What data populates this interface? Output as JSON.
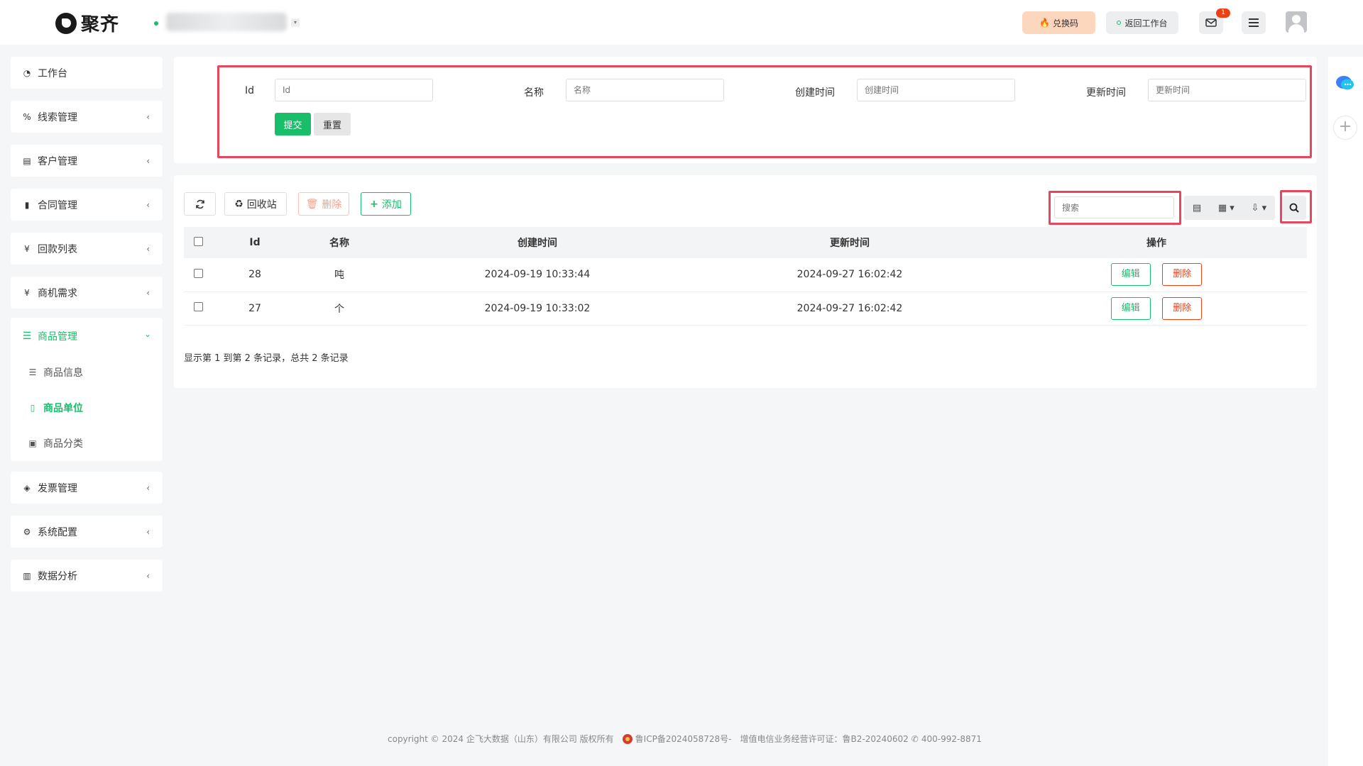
{
  "header": {
    "brand": "聚齐",
    "redeem_label": "兑换码",
    "back_label": "返回工作台",
    "mail_count": "1"
  },
  "sidebar": {
    "items": [
      {
        "label": "工作台",
        "icon": "dashboard-icon"
      },
      {
        "label": "线索管理",
        "icon": "link-icon"
      },
      {
        "label": "客户管理",
        "icon": "id-card-icon"
      },
      {
        "label": "合同管理",
        "icon": "bookmark-icon"
      },
      {
        "label": "回款列表",
        "icon": "yen-icon"
      },
      {
        "label": "商机需求",
        "icon": "yen-icon"
      }
    ],
    "group": {
      "label": "商品管理",
      "icon": "list-icon",
      "children": [
        {
          "label": "商品信息",
          "icon": "list-indent-icon"
        },
        {
          "label": "商品单位",
          "icon": "file-icon"
        },
        {
          "label": "商品分类",
          "icon": "calendar-plus-icon"
        }
      ]
    },
    "bottom_items": [
      {
        "label": "发票管理",
        "icon": "tag-icon"
      },
      {
        "label": "系统配置",
        "icon": "gears-icon"
      },
      {
        "label": "数据分析",
        "icon": "bar-chart-icon"
      }
    ]
  },
  "filter": {
    "fields": [
      {
        "label": "Id",
        "placeholder": "Id"
      },
      {
        "label": "名称",
        "placeholder": "名称"
      },
      {
        "label": "创建时间",
        "placeholder": "创建时间"
      },
      {
        "label": "更新时间",
        "placeholder": "更新时间"
      }
    ],
    "submit_label": "提交",
    "reset_label": "重置"
  },
  "toolbar": {
    "recycle_label": "回收站",
    "delete_label": "删除",
    "add_label": "添加",
    "search_placeholder": "搜索"
  },
  "table": {
    "columns": [
      "Id",
      "名称",
      "创建时间",
      "更新时间",
      "操作"
    ],
    "rows": [
      {
        "id": "28",
        "name": "吨",
        "created": "2024-09-19 10:33:44",
        "updated": "2024-09-27 16:02:42"
      },
      {
        "id": "27",
        "name": "个",
        "created": "2024-09-19 10:33:02",
        "updated": "2024-09-27 16:02:42"
      }
    ],
    "edit_label": "编辑",
    "delete_label": "删除",
    "summary": "显示第 1 到第 2 条记录，总共 2 条记录"
  },
  "footer": {
    "copyright": "copyright © 2024 企飞大数据（山东）有限公司 版权所有",
    "icp": "鲁ICP备2024058728号-",
    "license": "增值电信业务经营许可证：鲁B2-20240602",
    "phone": "400-992-8871"
  },
  "colors": {
    "primary": "#19be6b",
    "danger": "#ed4014",
    "highlight": "#e8455f"
  }
}
